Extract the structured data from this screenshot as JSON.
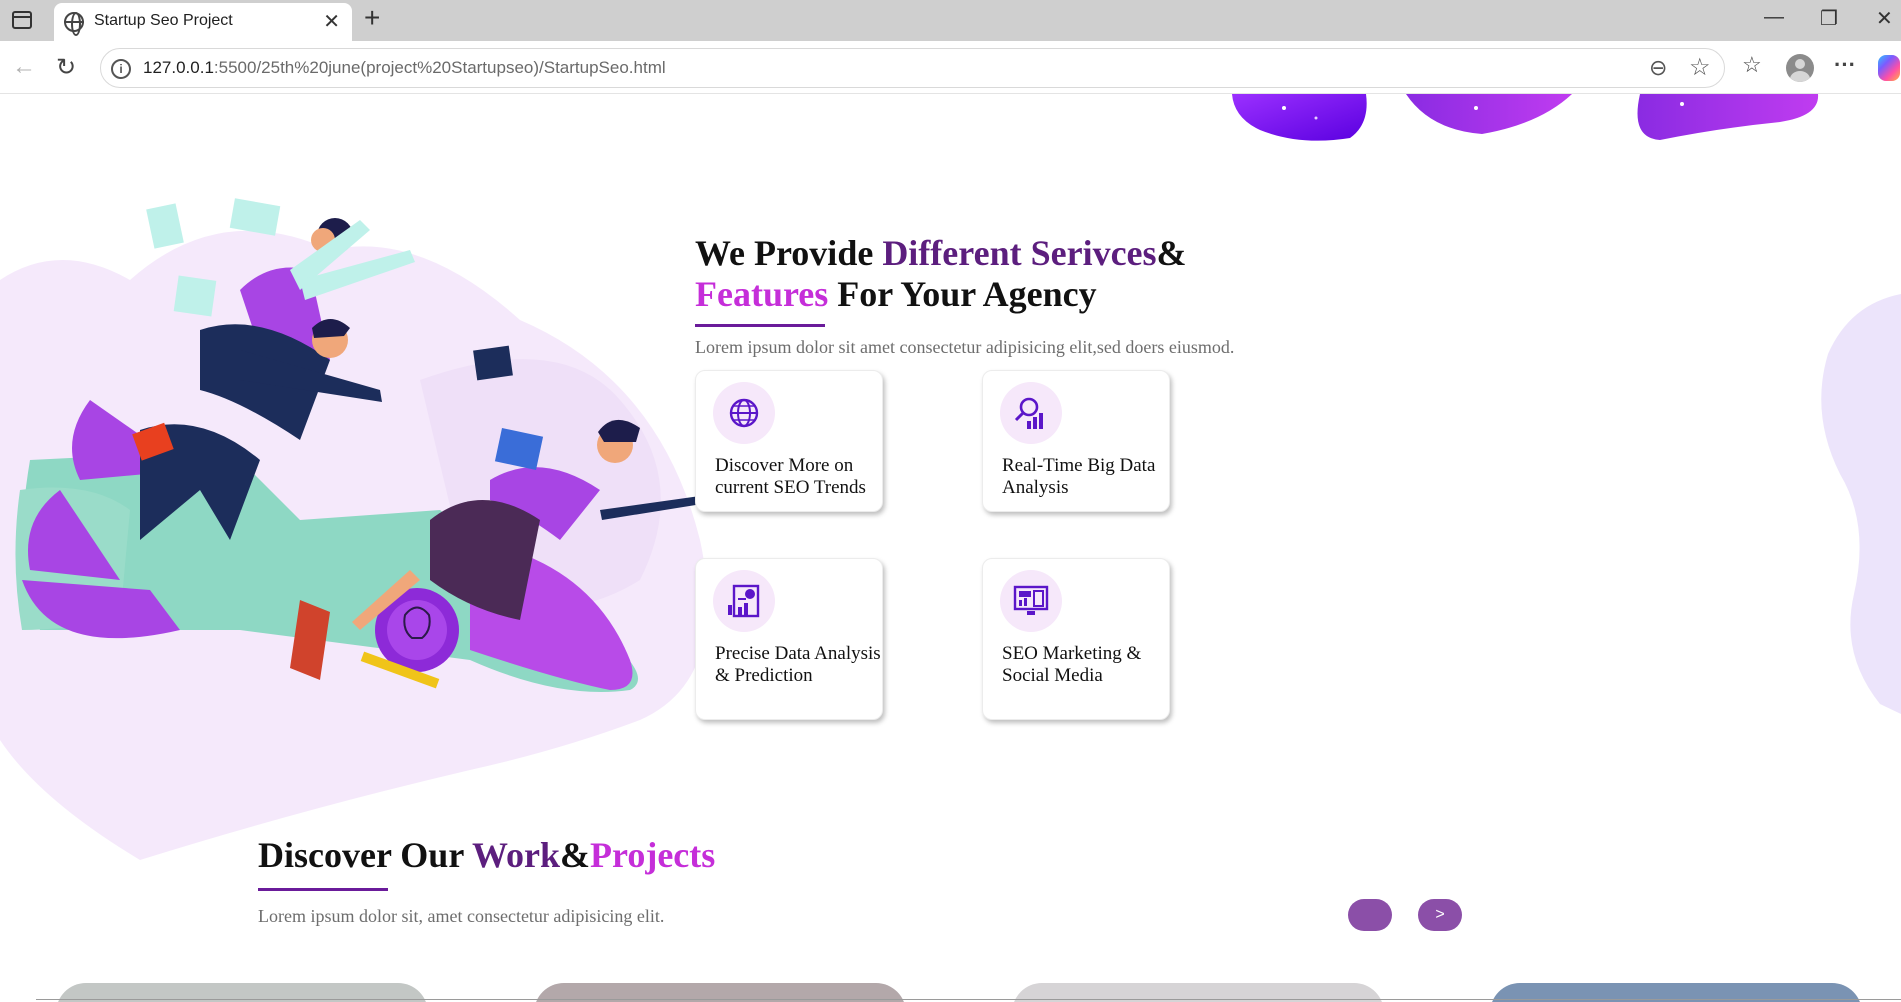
{
  "browser": {
    "tab_title": "Startup Seo Project",
    "tab_close": "✕",
    "new_tab": "+",
    "url_host": "127.0.0.1",
    "url_rest": ":5500/25th%20june(project%20Startupseo)/StartupSeo.html",
    "minimize": "—",
    "restore": "❐",
    "close": "✕",
    "back": "←",
    "reload": "↻",
    "info": "i",
    "zoom": "⊖",
    "star": "☆",
    "favorites": "☆",
    "more": "···"
  },
  "services": {
    "title_part1": "We Provide ",
    "title_part2": "Different Serivces",
    "title_part3": "&",
    "title_part4": "Features",
    "title_part5": " For Your Agency",
    "subtitle": "Lorem ipsum dolor sit amet consectetur adipisicing elit,sed doers eiusmod.",
    "cards": [
      {
        "label": "Discover More on current SEO Trends",
        "icon": "globe-dollar-icon"
      },
      {
        "label": "Real-Time Big Data Analysis",
        "icon": "magnifier-chart-icon"
      },
      {
        "label": "Precise Data Analysis & Prediction",
        "icon": "report-chart-icon"
      },
      {
        "label": "SEO Marketing & Social Media",
        "icon": "monitor-ads-icon"
      }
    ]
  },
  "work": {
    "title_part1": "Discover Our ",
    "title_part2": "Work",
    "title_part3": "&",
    "title_part4": "Projects",
    "subtitle": "Lorem ipsum dolor sit, amet consectetur adipisicing elit.",
    "prev_label": "",
    "next_label": ">"
  },
  "colors": {
    "brand_purple": "#5c1e7e",
    "brand_pink": "#c52ed9",
    "button_purple": "#8b4fa8"
  }
}
